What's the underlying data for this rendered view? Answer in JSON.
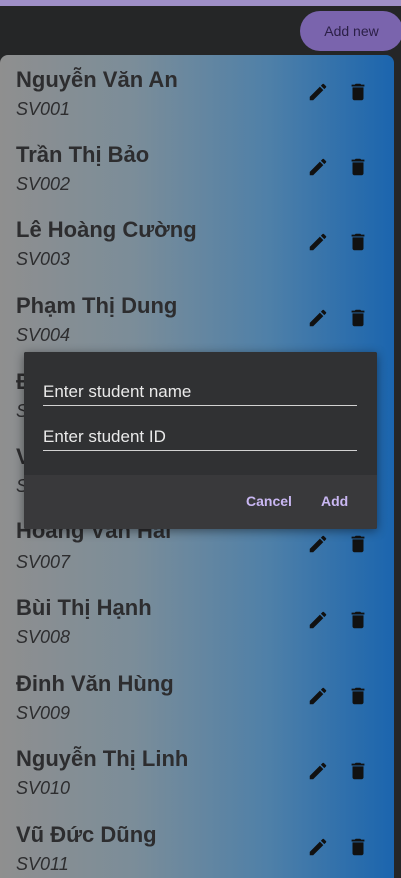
{
  "header": {
    "add_new_label": "Add new"
  },
  "students": [
    {
      "name": "Nguyễn Văn An",
      "id": "SV001"
    },
    {
      "name": "Trần Thị Bảo",
      "id": "SV002"
    },
    {
      "name": "Lê Hoàng Cường",
      "id": "SV003"
    },
    {
      "name": "Phạm Thị Dung",
      "id": "SV004"
    },
    {
      "name": "Đ",
      "id": "S"
    },
    {
      "name": "V",
      "id": "S"
    },
    {
      "name": "Hoàng Văn Hải",
      "id": "SV007"
    },
    {
      "name": "Bùi Thị Hạnh",
      "id": "SV008"
    },
    {
      "name": "Đinh Văn Hùng",
      "id": "SV009"
    },
    {
      "name": "Nguyễn Thị Linh",
      "id": "SV010"
    },
    {
      "name": "Vũ Đức Dũng",
      "id": "SV011"
    }
  ],
  "dialog": {
    "name_placeholder": "Enter student name",
    "id_placeholder": "Enter student ID",
    "name_value": "",
    "id_value": "",
    "cancel_label": "Cancel",
    "add_label": "Add"
  },
  "icons": {
    "edit": "pencil-icon",
    "delete": "trash-icon"
  },
  "colors": {
    "accent": "#7a64ad",
    "dialog_button_text": "#c9b7f2",
    "background": "#252627"
  }
}
